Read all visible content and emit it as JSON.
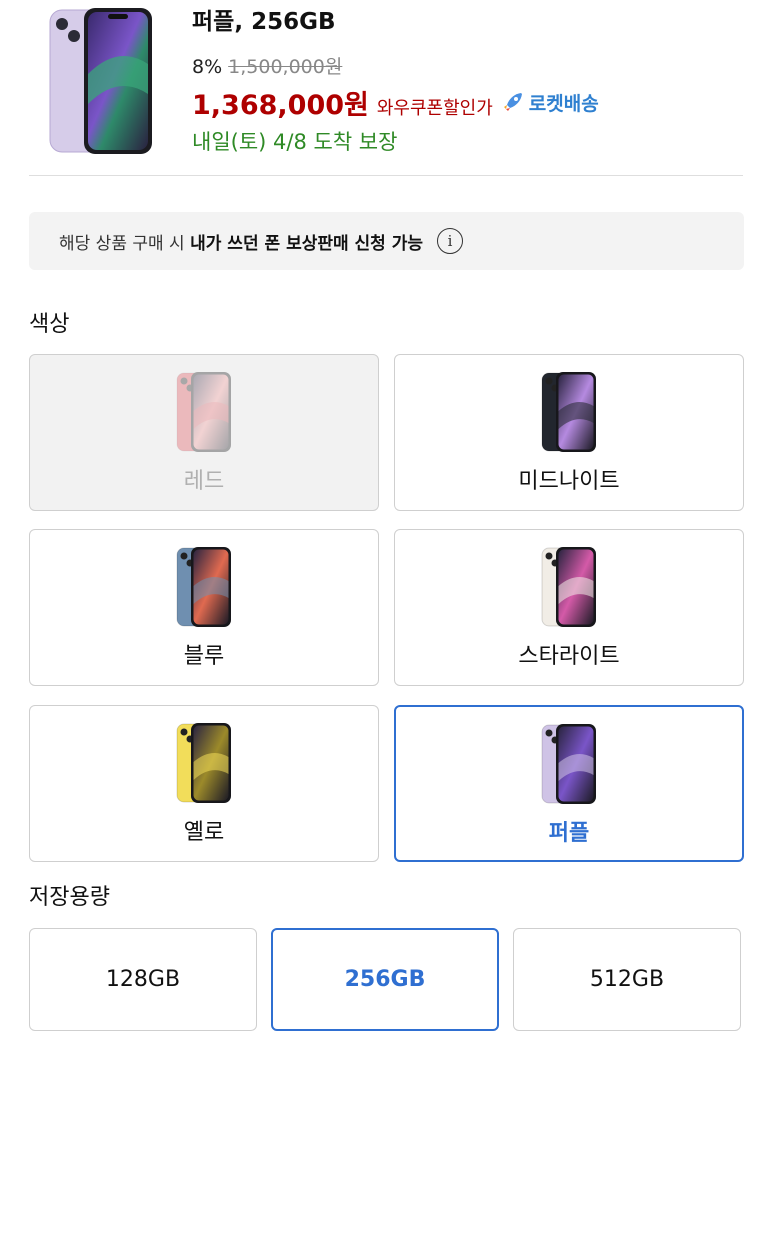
{
  "product": {
    "title": "퍼플, 256GB",
    "discount_rate": "8%",
    "original_price": "1,500,000원",
    "sale_price": "1,368,000원",
    "coupon_text": "와우쿠폰할인가",
    "rocket_label": "로켓배송",
    "delivery": "내일(토) 4/8 도착 보장",
    "image_icon": "phone-purple-image"
  },
  "notice": {
    "text_prefix": "해당 상품 구매 시",
    "text_bold": "내가 쓰던 폰 보상판매 신청 가능",
    "info_glyph": "i"
  },
  "color_section": {
    "label": "색상",
    "options": [
      {
        "label": "레드",
        "state": "disabled",
        "body": "#e0505a",
        "accent": "#f39a9a"
      },
      {
        "label": "미드나이트",
        "state": "normal",
        "body": "#22262e",
        "accent": "#b58ae0"
      },
      {
        "label": "블루",
        "state": "normal",
        "body": "#6f8fb0",
        "accent": "#e06a50"
      },
      {
        "label": "스타라이트",
        "state": "normal",
        "body": "#f1ede6",
        "accent": "#d45aa8"
      },
      {
        "label": "옐로",
        "state": "normal",
        "body": "#f2dd5a",
        "accent": "#9c8a2a"
      },
      {
        "label": "퍼플",
        "state": "selected",
        "body": "#cfc3e6",
        "accent": "#7a55c8"
      }
    ]
  },
  "storage_section": {
    "label": "저장용량",
    "options": [
      {
        "label": "128GB",
        "state": "normal"
      },
      {
        "label": "256GB",
        "state": "selected"
      },
      {
        "label": "512GB",
        "state": "normal"
      }
    ]
  },
  "colors": {
    "accent_blue": "#2f6fd1",
    "price_red": "#ae0000",
    "delivery_green": "#2f8a26",
    "rocket_blue": "#2f80d0"
  }
}
